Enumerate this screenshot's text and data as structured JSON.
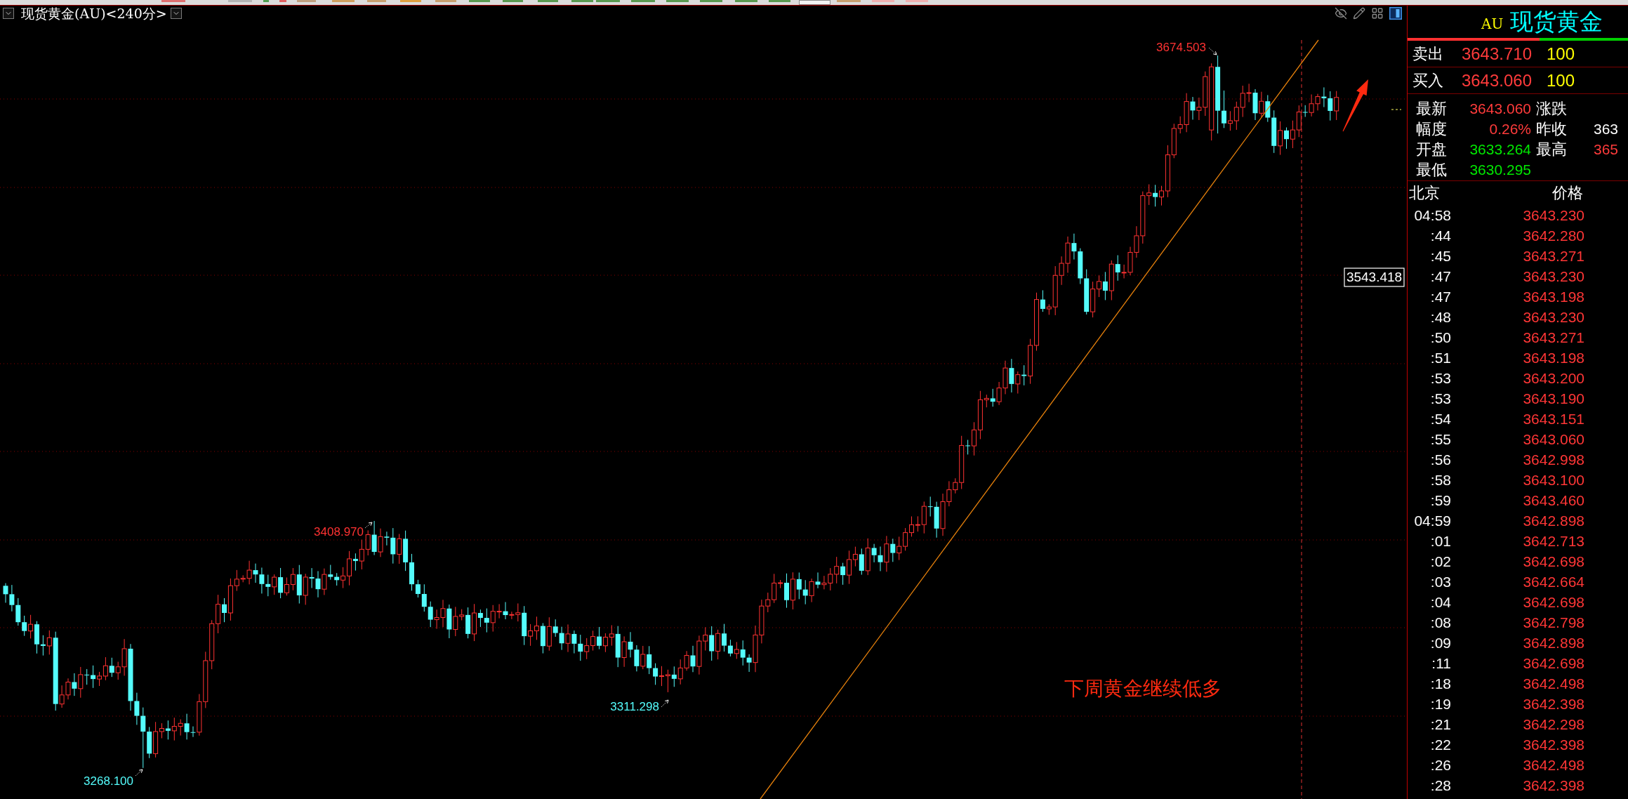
{
  "chart_header": {
    "title": "现货黄金(AU)<240分>"
  },
  "chart": {
    "extreme_labels": [
      {
        "kind": "high",
        "text": "3674.503"
      },
      {
        "kind": "high",
        "text": "3408.970"
      },
      {
        "kind": "low",
        "text": "3311.298"
      },
      {
        "kind": "low",
        "text": "3268.100"
      }
    ],
    "price_tag": "3543.418",
    "annotation": "下周黄金继续低多"
  },
  "quote_panel": {
    "code": "AU",
    "name": "现货黄金",
    "ratio_bar": {
      "level": 0.6
    },
    "orders": [
      {
        "label": "卖出",
        "price": "3643.710",
        "volume": "100"
      },
      {
        "label": "买入",
        "price": "3643.060",
        "volume": "100"
      }
    ],
    "stats": [
      {
        "label": "最新",
        "value": "3643.060",
        "color": "#ff3b3b"
      },
      {
        "label": "涨跌"
      },
      {
        "label": "幅度",
        "value": "0.26%",
        "color": "#ff3b3b"
      },
      {
        "label": "昨收",
        "value": "363",
        "color": "#ffffff"
      },
      {
        "label": "开盘",
        "value": "3633.264",
        "color": "#00e800"
      },
      {
        "label": "最高",
        "value": "365",
        "color": "#ff3b3b"
      },
      {
        "label": "最低",
        "value": "3630.295",
        "color": "#00e800"
      }
    ],
    "ticks_header": {
      "time": "北京",
      "price": "价格"
    },
    "ticks": [
      {
        "time": "04:58",
        "price": "3643.230"
      },
      {
        "time": ":44",
        "price": "3642.280"
      },
      {
        "time": ":45",
        "price": "3643.271"
      },
      {
        "time": ":47",
        "price": "3643.230"
      },
      {
        "time": ":47",
        "price": "3643.198"
      },
      {
        "time": ":48",
        "price": "3643.230"
      },
      {
        "time": ":50",
        "price": "3643.271"
      },
      {
        "time": ":51",
        "price": "3643.198"
      },
      {
        "time": ":53",
        "price": "3643.200"
      },
      {
        "time": ":53",
        "price": "3643.190"
      },
      {
        "time": ":54",
        "price": "3643.151"
      },
      {
        "time": ":55",
        "price": "3643.060"
      },
      {
        "time": ":56",
        "price": "3642.998"
      },
      {
        "time": ":58",
        "price": "3643.100"
      },
      {
        "time": ":59",
        "price": "3643.460"
      },
      {
        "time": "04:59",
        "price": "3642.898"
      },
      {
        "time": ":01",
        "price": "3642.713"
      },
      {
        "time": ":02",
        "price": "3642.698"
      },
      {
        "time": ":03",
        "price": "3642.664"
      },
      {
        "time": ":04",
        "price": "3642.698"
      },
      {
        "time": ":08",
        "price": "3642.798"
      },
      {
        "time": ":09",
        "price": "3642.898"
      },
      {
        "time": ":11",
        "price": "3642.698"
      },
      {
        "time": ":18",
        "price": "3642.498"
      },
      {
        "time": ":19",
        "price": "3642.398"
      },
      {
        "time": ":21",
        "price": "3642.298"
      },
      {
        "time": ":22",
        "price": "3642.398"
      },
      {
        "time": ":26",
        "price": "3642.498"
      },
      {
        "time": ":28",
        "price": "3642.398"
      }
    ]
  }
}
